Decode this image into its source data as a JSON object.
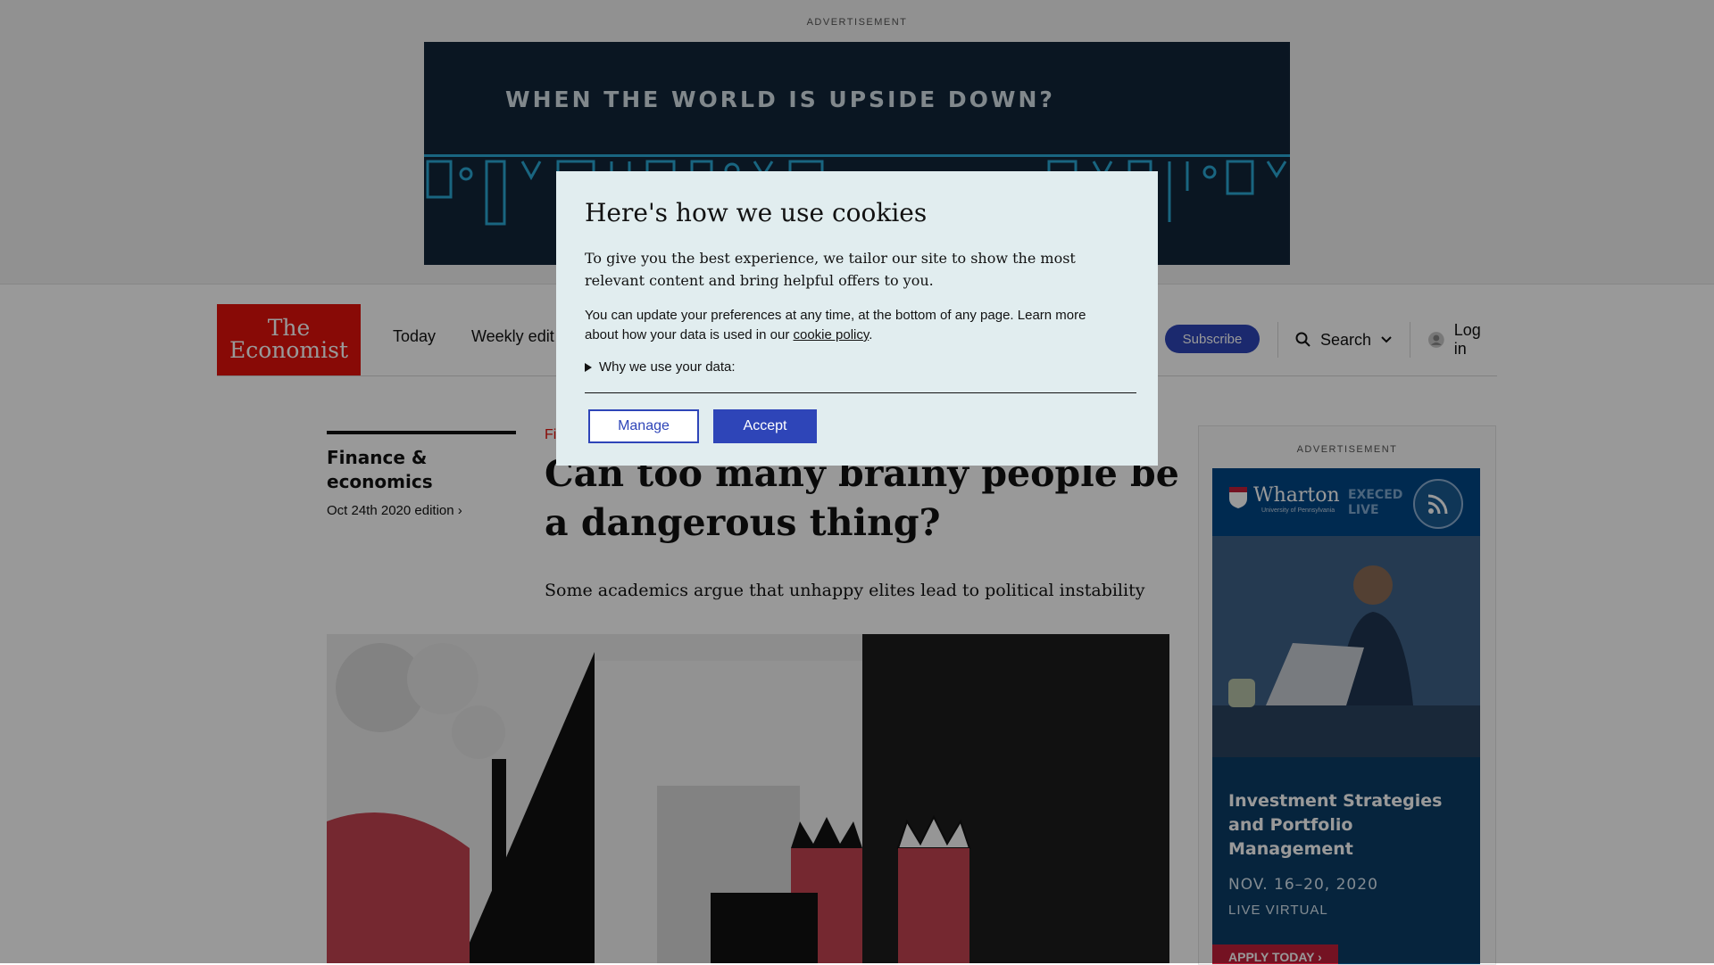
{
  "top_ad": {
    "label": "ADVERTISEMENT",
    "headline": "WHEN THE WORLD IS UPSIDE DOWN?"
  },
  "nav": {
    "logo_line1": "The",
    "logo_line2": "Economist",
    "links": [
      "Today",
      "Weekly edit"
    ],
    "subscribe": "Subscribe",
    "search": "Search",
    "login": "Log in"
  },
  "article": {
    "section": "Finance & economics",
    "edition": "Oct 24th 2020 edition",
    "rubric": "Fi",
    "headline": "Can too many brainy people be a dangerous thing?",
    "standfirst": "Some academics argue that unhappy elites lead to political instability"
  },
  "side_ad": {
    "label": "ADVERTISEMENT",
    "brand": "Wharton",
    "brand_sub": "University of Pennsylvania",
    "program_line1": "EXECED",
    "program_line2": "LIVE",
    "title": "Investment Strategies and Portfolio Management",
    "dates": "NOV. 16–20, 2020",
    "format": "LIVE VIRTUAL",
    "cta": "APPLY TODAY ›"
  },
  "cookie_modal": {
    "title": "Here's how we use cookies",
    "lead": "To give you the best experience, we tailor our site to show the most relevant content and bring helpful offers to you.",
    "body_text": "You can update your preferences at any time, at the bottom of any page. Learn more about how your data is used in our",
    "policy_link": "cookie policy",
    "details_label": "Why we use your data:",
    "manage_label": "Manage",
    "accept_label": "Accept"
  },
  "colors": {
    "brand_red": "#e3120b",
    "button_blue": "#2e45b8",
    "modal_bg": "#e1edef"
  }
}
